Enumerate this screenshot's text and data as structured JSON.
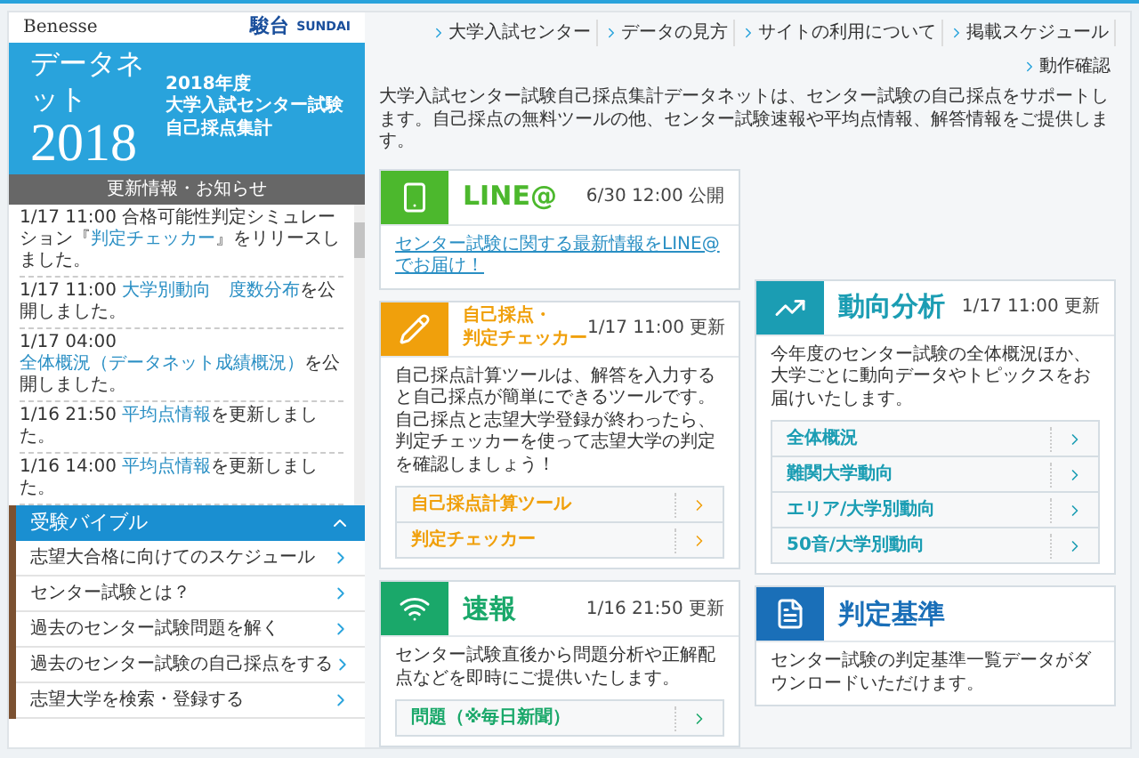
{
  "logos": {
    "benesse": "Benesse",
    "sundai_kanji": "駿台",
    "sundai": "SUNDAI"
  },
  "hero": {
    "title": "データネット",
    "year": "2018",
    "subtitle_year": "2018年度",
    "subtitle_lines": [
      "大学入試センター試験",
      "自己採点集計"
    ]
  },
  "news": {
    "title": "更新情報・お知らせ",
    "items": [
      {
        "date": "1/17 11:00",
        "before": "合格可能性判定シミュレーション『",
        "link": "判定チェッカー",
        "after": "』をリリースしました。"
      },
      {
        "date": "1/17 11:00",
        "link": "大学別動向　度数分布",
        "after": "を公開しました。"
      },
      {
        "date": "1/17 04:00",
        "link": "全体概況（データネット成績概況）",
        "after": "を公開しました。"
      },
      {
        "date": "1/16 21:50",
        "link": "平均点情報",
        "after": "を更新しました。"
      },
      {
        "date": "1/16 14:00",
        "link": "平均点情報",
        "after": "を更新しました。"
      }
    ]
  },
  "bible": {
    "title": "受験バイブル",
    "expanded": true,
    "items": [
      "志望大合格に向けてのスケジュール",
      "センター試験とは？",
      "過去のセンター試験問題を解く",
      "過去のセンター試験の自己採点をする",
      "志望大学を検索・登録する"
    ]
  },
  "nav": [
    "大学入試センター",
    "データの見方",
    "サイトの利用について",
    "掲載スケジュール",
    "動作確認"
  ],
  "intro": "大学入試センター試験自己採点集計データネットは、センター試験の自己採点をサポートします。自己採点の無料ツールの他、センター試験速報や平均点情報、解答情報をご提供します。",
  "columns": [
    [
      {
        "kind": "phone",
        "color": "#4cb82d",
        "title_lines": [
          "LINE@"
        ],
        "stamp": "6/30 12:00 公開",
        "link": "センター試験に関する最新情報をLINE@でお届け！"
      },
      {
        "kind": "pencil",
        "color": "#f0a00c",
        "title_lines": [
          "自己採点・",
          "判定チェッカー"
        ],
        "stamp": "1/17 11:00 更新",
        "text": "自己採点計算ツールは、解答を入力すると自己採点が簡単にできるツールです。自己採点と志望大学登録が終わったら、判定チェッカーを使って志望大学の判定を確認しましょう！",
        "links": [
          "自己採点計算ツール",
          "判定チェッカー"
        ]
      },
      {
        "kind": "wifi",
        "color": "#1aa86a",
        "title_lines": [
          "速報"
        ],
        "stamp": "1/16 21:50 更新",
        "text": "センター試験直後から問題分析や正解配点などを即時にご提供いたします。",
        "links": [
          "問題（※毎日新聞）"
        ]
      }
    ],
    [
      {
        "kind": "chart",
        "color": "#1b9db3",
        "title_lines": [
          "動向分析"
        ],
        "stamp": "1/17 11:00 更新",
        "text": "今年度のセンター試験の全体概況ほか、大学ごとに動向データやトピックスをお届けいたします。",
        "links": [
          "全体概況",
          "難関大学動向",
          "エリア/大学別動向",
          "50音/大学別動向"
        ]
      },
      {
        "kind": "document",
        "color": "#1a6fb8",
        "title_lines": [
          "判定基準"
        ],
        "text": "センター試験の判定基準一覧データがダウンロードいただけます。"
      }
    ]
  ]
}
